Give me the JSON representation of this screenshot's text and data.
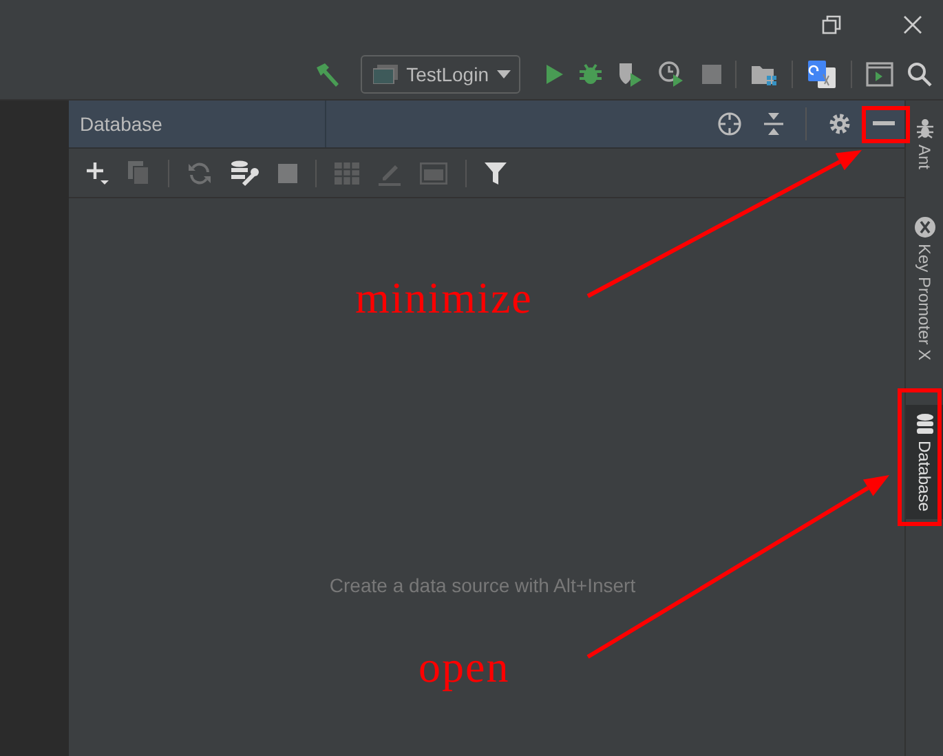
{
  "title_bar": {
    "controls": [
      {
        "kind": "restore"
      },
      {
        "kind": "close"
      }
    ]
  },
  "main_toolbar": {
    "items": [
      {
        "kind": "build",
        "disabled": false
      },
      {
        "kind": "run_config",
        "label": "TestLogin"
      },
      {
        "kind": "run",
        "disabled": false
      },
      {
        "kind": "debug",
        "disabled": false
      },
      {
        "kind": "coverage",
        "disabled": false
      },
      {
        "kind": "profile",
        "disabled": false
      },
      {
        "kind": "stop",
        "disabled": true
      },
      {
        "kind": "sep"
      },
      {
        "kind": "project",
        "disabled": false
      },
      {
        "kind": "sep"
      },
      {
        "kind": "translate",
        "disabled": false
      },
      {
        "kind": "sep"
      },
      {
        "kind": "terminal",
        "disabled": false
      },
      {
        "kind": "search",
        "disabled": false
      }
    ]
  },
  "tool_window": {
    "title": "Database",
    "header_actions": [
      {
        "kind": "locate"
      },
      {
        "kind": "collapse"
      },
      {
        "kind": "sep"
      },
      {
        "kind": "gear"
      },
      {
        "kind": "minimize"
      }
    ],
    "toolbar": [
      {
        "kind": "add",
        "disabled": false
      },
      {
        "kind": "copy",
        "disabled": true
      },
      {
        "kind": "sep"
      },
      {
        "kind": "refresh",
        "disabled": true
      },
      {
        "kind": "tools",
        "disabled": false
      },
      {
        "kind": "stop",
        "disabled": true
      },
      {
        "kind": "sep"
      },
      {
        "kind": "table",
        "disabled": true
      },
      {
        "kind": "edit",
        "disabled": true
      },
      {
        "kind": "console",
        "disabled": true
      },
      {
        "kind": "sep"
      },
      {
        "kind": "filter",
        "disabled": false
      }
    ],
    "empty_text": "Create a data source with Alt+Insert"
  },
  "right_stripe": [
    {
      "label": "Ant",
      "kind": "ant",
      "selected": false
    },
    {
      "label": "Key Promoter X",
      "kind": "keypromoter",
      "selected": false
    },
    {
      "label": "Database",
      "kind": "database",
      "selected": true
    }
  ],
  "annotations": [
    {
      "text": "minimize"
    },
    {
      "text": "open"
    }
  ]
}
